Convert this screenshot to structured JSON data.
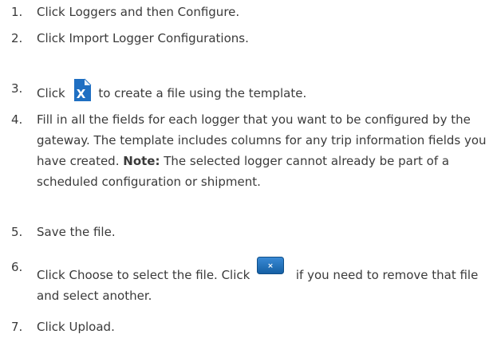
{
  "steps": [
    {
      "number": "1.",
      "text": "Click Loggers and then Configure."
    },
    {
      "number": "2.",
      "text": "Click Import Logger Configurations."
    },
    {
      "number": "3.",
      "before": "Click",
      "after": "to create a file using the template.",
      "icon": "excel-file-icon"
    },
    {
      "number": "4.",
      "text": "Fill in all the fields for each logger that you want to be configured by the gateway. The template includes columns for any trip information fields you have created.",
      "note_label": "Note:",
      "note_text": "The selected logger cannot already be part of a scheduled configuration or shipment."
    },
    {
      "number": "5.",
      "text": "Save the file."
    },
    {
      "number": "6.",
      "before": "Click Choose to select the file. Click",
      "after": "if you need to remove that file and select another.",
      "icon": "remove-file-icon"
    },
    {
      "number": "7.",
      "text": "Click Upload."
    }
  ],
  "colors": {
    "text": "#3a3a3a",
    "excel_icon": "#1f6fc2",
    "remove_button": "#1c6fb8"
  }
}
